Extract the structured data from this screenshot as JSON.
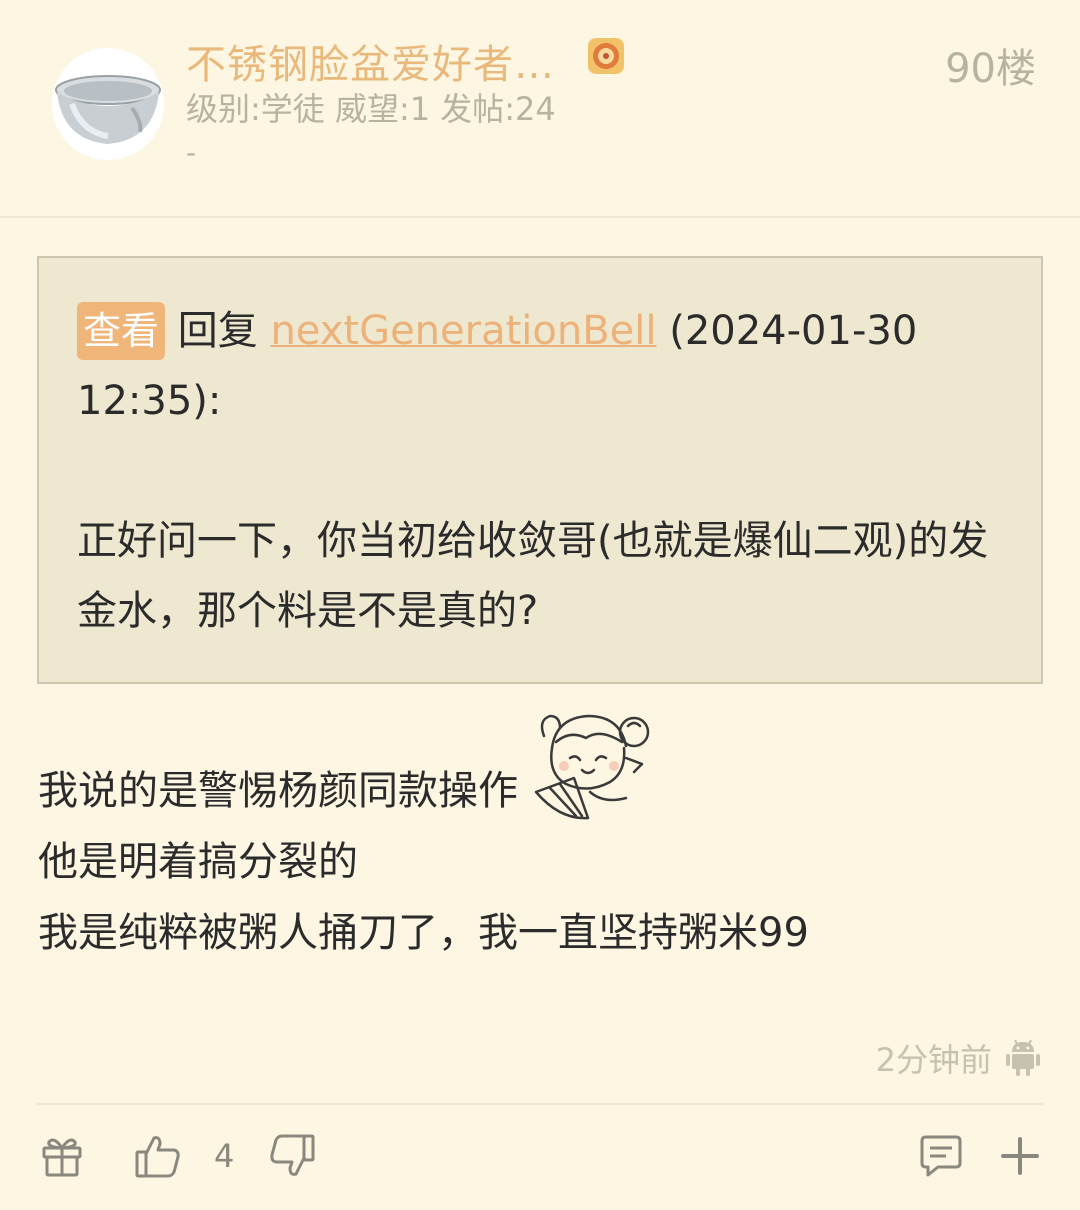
{
  "header": {
    "username": "不锈钢脸盆爱好者…",
    "level_text": "级别:学徒 威望:1 发帖:24",
    "signature": "-",
    "floor": "90楼"
  },
  "quote": {
    "view_label": "查看",
    "reply_word": "回复",
    "reply_user": "nextGenerationBell",
    "reply_time": "(2024-01-30 12:35):",
    "text": "正好问一下，你当初给收敛哥(也就是爆仙二观)的发金水，那个料是不是真的?"
  },
  "body": {
    "lines": [
      "我说的是警惕杨颜同款操作",
      "他是明着搞分裂的",
      "我是纯粹被粥人捅刀了，我一直坚持粥米99"
    ]
  },
  "footer": {
    "time": "2分钟前",
    "platform_icon": "android-icon",
    "like_count": "4"
  },
  "icons": {
    "gift": "gift-icon",
    "like": "thumbs-up-icon",
    "dislike": "thumbs-down-icon",
    "comment": "comment-icon",
    "more": "plus-icon"
  },
  "colors": {
    "background": "#fcf6e3",
    "accent": "#f0b578",
    "username": "#e9b97c",
    "quote_bg": "#efe8d0"
  }
}
